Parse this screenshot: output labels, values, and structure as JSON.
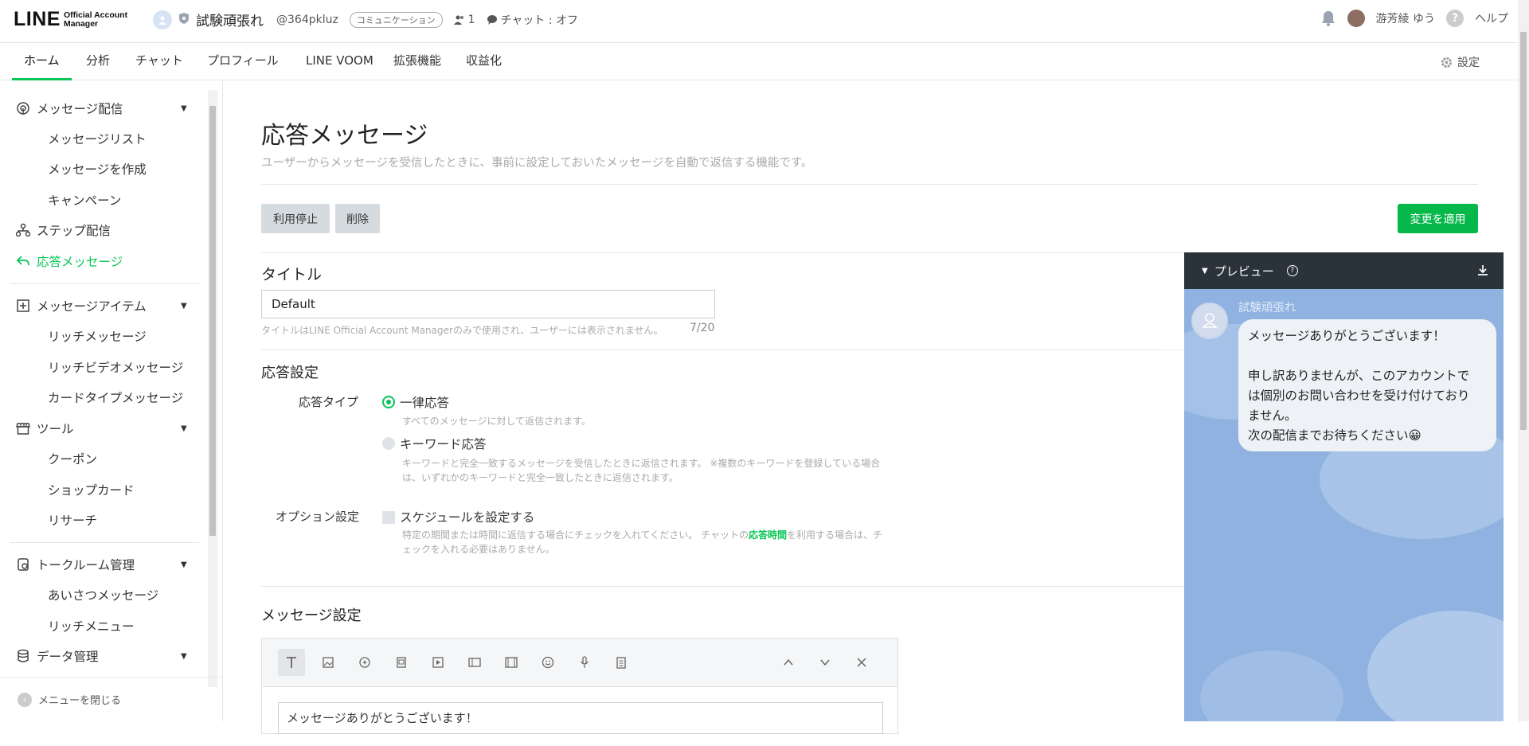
{
  "header": {
    "logo_main": "LINE",
    "logo_sub_line1": "Official Account",
    "logo_sub_line2": "Manager",
    "account_name": "試験頑張れ",
    "account_id": "@364pkluz",
    "account_tag": "コミュニケーション",
    "friends_count": "1",
    "chat_status": "チャット : オフ",
    "user_name": "游芳綾 ゆう",
    "help_label": "ヘルプ"
  },
  "nav": {
    "tabs": [
      "ホーム",
      "分析",
      "チャット",
      "プロフィール",
      "LINE VOOM",
      "拡張機能",
      "収益化"
    ],
    "active_tab": "ホーム",
    "settings_label": "設定"
  },
  "sidebar": {
    "sections": {
      "message_delivery": "メッセージ配信",
      "message_list": "メッセージリスト",
      "create_message": "メッセージを作成",
      "campaign": "キャンペーン",
      "step_delivery": "ステップ配信",
      "auto_reply": "応答メッセージ",
      "message_items": "メッセージアイテム",
      "rich_message": "リッチメッセージ",
      "rich_video": "リッチビデオメッセージ",
      "card_message": "カードタイプメッセージ",
      "tools": "ツール",
      "coupon": "クーポン",
      "shop_card": "ショップカード",
      "research": "リサーチ",
      "talkroom": "トークルーム管理",
      "greeting": "あいさつメッセージ",
      "rich_menu": "リッチメニュー",
      "data_mgmt": "データ管理"
    },
    "close_menu": "メニューを閉じる"
  },
  "main": {
    "title": "応答メッセージ",
    "description": "ユーザーからメッセージを受信したときに、事前に設定しておいたメッセージを自動で返信する機能です。",
    "btn_pause": "利用停止",
    "btn_delete": "削除",
    "btn_apply": "変更を適用",
    "title_section": "タイトル",
    "title_value": "Default",
    "title_hint": "タイトルはLINE Official Account Managerのみで使用され、ユーザーには表示されません。",
    "title_counter": "7/20",
    "reply_settings": "応答設定",
    "reply_type_label": "応答タイプ",
    "opt_uniform": "一律応答",
    "opt_uniform_hint": "すべてのメッセージに対して返信されます。",
    "opt_keyword": "キーワード応答",
    "opt_keyword_hint1": "キーワードと完全一致するメッセージを受信したときに返信されます。 ※複数のキーワードを登録している場合",
    "opt_keyword_hint2": "は、いずれかのキーワードと完全一致したときに返信されます。",
    "option_label": "オプション設定",
    "schedule_label": "スケジュールを設定する",
    "schedule_hint1a": "特定の期間または時間に返信する場合にチェックを入れてください。 チャットの",
    "schedule_hint1_link": "応答時間",
    "schedule_hint1b": "を利用する場合は、チ",
    "schedule_hint2": "ェックを入れる必要はありません。",
    "message_settings": "メッセージ設定",
    "editor_text": "メッセージありがとうございます！"
  },
  "preview": {
    "title": "プレビュー",
    "sender": "試験頑張れ",
    "message": "メッセージありがとうございます！\n\n申し訳ありませんが、このアカウントで\nは個別のお問い合わせを受け付けており\nません。\n次の配信までお待ちください😀"
  },
  "colors": {
    "brand_green": "#06c755",
    "preview_bg": "#8fb2e1",
    "preview_header": "#2a323a"
  }
}
